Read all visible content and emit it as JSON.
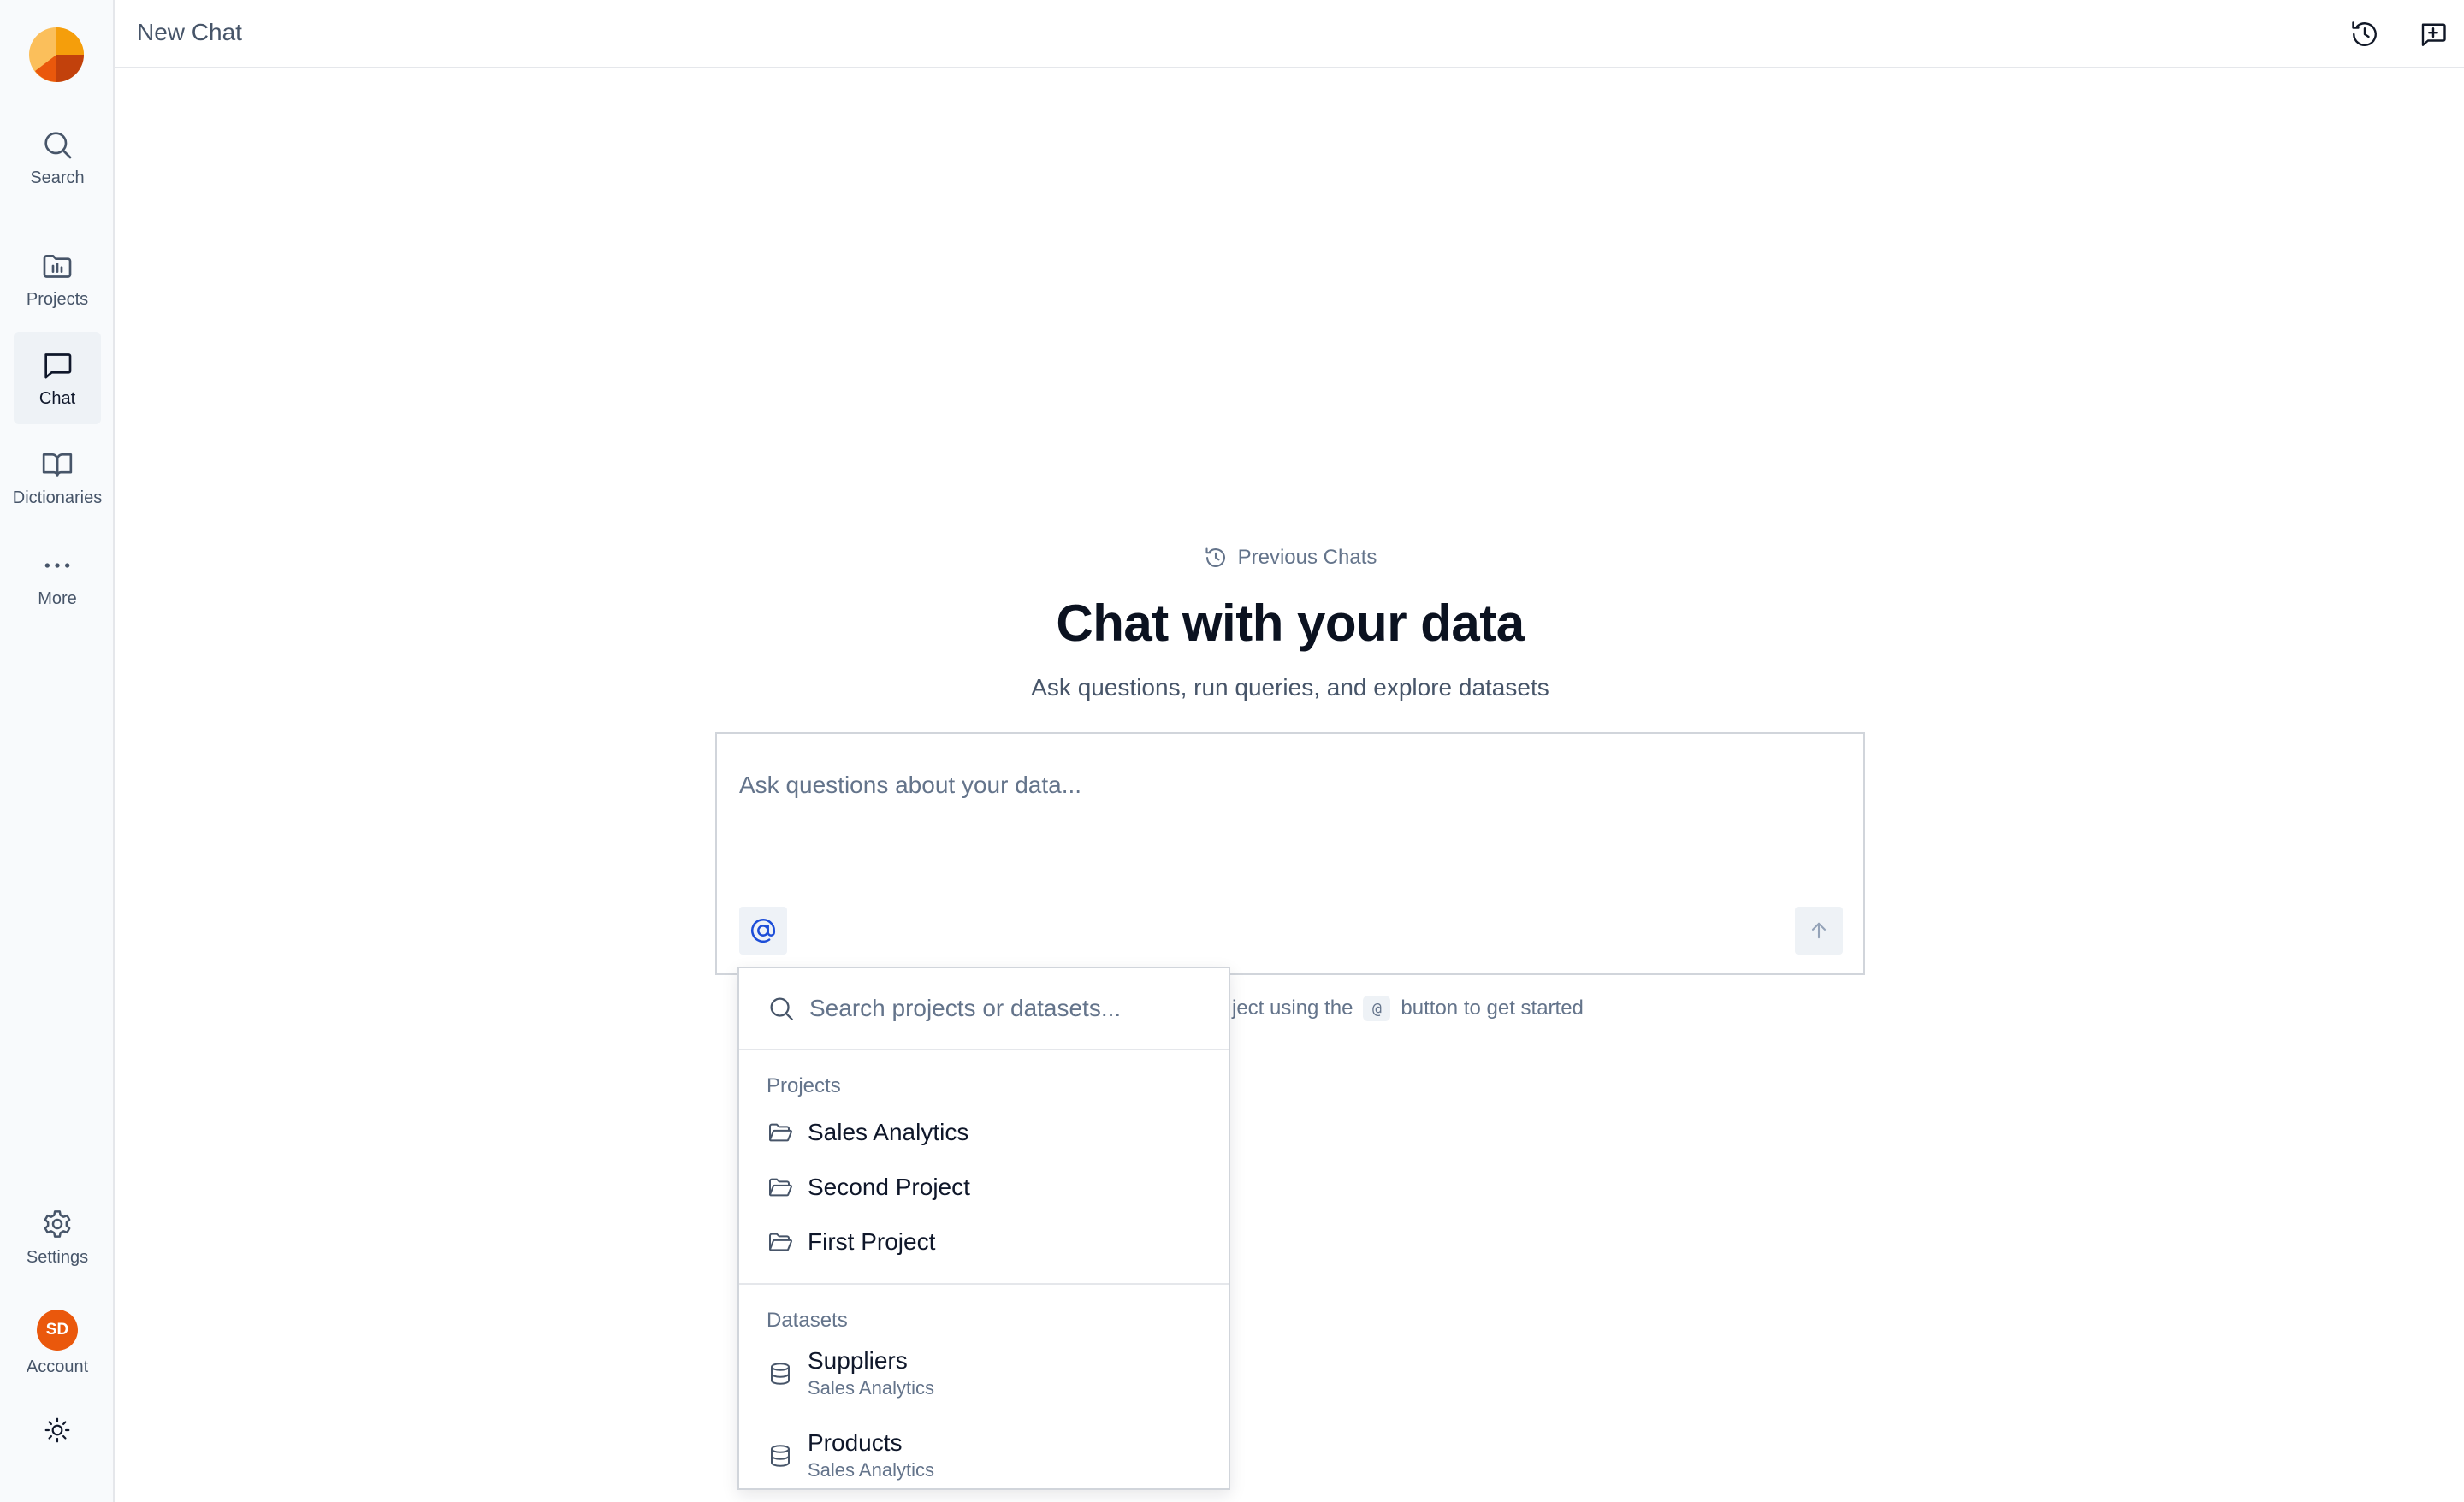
{
  "colors": {
    "accent": "#1d4ed8",
    "avatar": "#ea580c",
    "logo_light": "#f59e0b",
    "logo_dark": "#c2410c"
  },
  "sidebar": {
    "items": [
      {
        "label": "Search",
        "icon": "search-icon"
      },
      {
        "label": "Projects",
        "icon": "folder-chart-icon"
      },
      {
        "label": "Chat",
        "icon": "chat-bubble-icon",
        "active": true
      },
      {
        "label": "Dictionaries",
        "icon": "book-open-icon"
      },
      {
        "label": "More",
        "icon": "more-dots-icon"
      }
    ],
    "settings_label": "Settings",
    "account_label": "Account",
    "avatar_initials": "SD"
  },
  "topbar": {
    "title": "New Chat",
    "history_icon": "history-icon",
    "new_chat_icon": "new-chat-icon"
  },
  "main": {
    "previous_chats": "Previous Chats",
    "title": "Chat with your data",
    "subtitle": "Ask questions, run queries, and explore datasets",
    "input_placeholder": "Ask questions about your data...",
    "hint_prefix": "ject using the",
    "hint_at": "@",
    "hint_suffix": "button to get started"
  },
  "dropdown": {
    "search_placeholder": "Search projects or datasets...",
    "projects_label": "Projects",
    "projects": [
      "Sales Analytics",
      "Second Project",
      "First Project"
    ],
    "datasets_label": "Datasets",
    "datasets": [
      {
        "name": "Suppliers",
        "project": "Sales Analytics"
      },
      {
        "name": "Products",
        "project": "Sales Analytics"
      }
    ]
  }
}
